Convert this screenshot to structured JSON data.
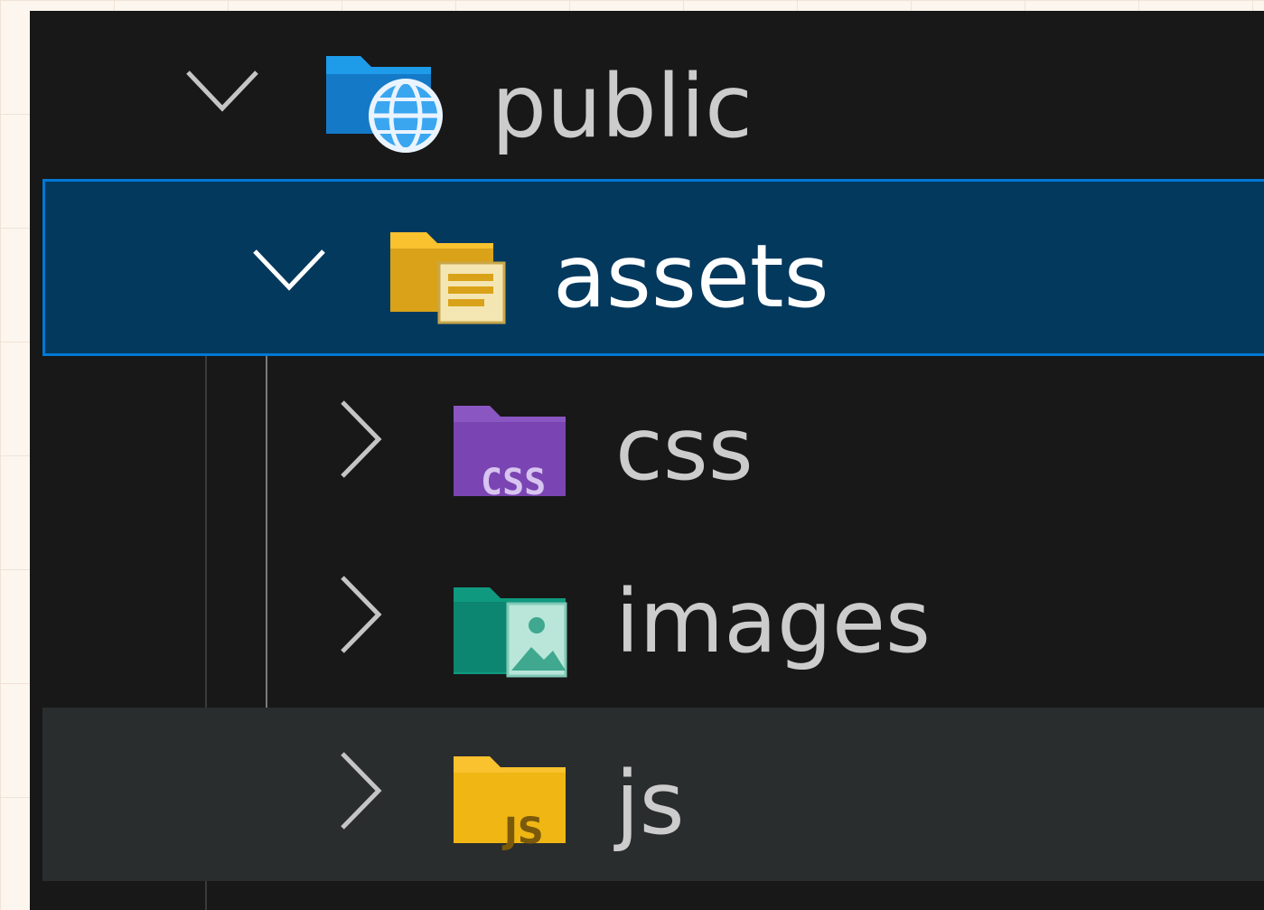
{
  "explorer": {
    "items": [
      {
        "label": "public",
        "icon": "folder-public-icon",
        "expanded": true,
        "selected": false,
        "hovered": false
      },
      {
        "label": "assets",
        "icon": "folder-assets-icon",
        "expanded": true,
        "selected": true,
        "hovered": false
      },
      {
        "label": "css",
        "icon": "folder-css-icon",
        "expanded": false,
        "selected": false,
        "hovered": false,
        "badge": "CSS"
      },
      {
        "label": "images",
        "icon": "folder-images-icon",
        "expanded": false,
        "selected": false,
        "hovered": false
      },
      {
        "label": "js",
        "icon": "folder-js-icon",
        "expanded": false,
        "selected": false,
        "hovered": true,
        "badge": "JS"
      }
    ]
  },
  "colors": {
    "panel_bg": "#181818",
    "selected_bg": "#04395e",
    "selected_border": "#0078d4",
    "hover_bg": "#2a2d2e",
    "text": "#cccccc",
    "folder_public": "#1e9be9",
    "folder_assets": "#f9c22e",
    "folder_css": "#8a56c2",
    "folder_images": "#0f9a80",
    "folder_js": "#f9c22e"
  }
}
